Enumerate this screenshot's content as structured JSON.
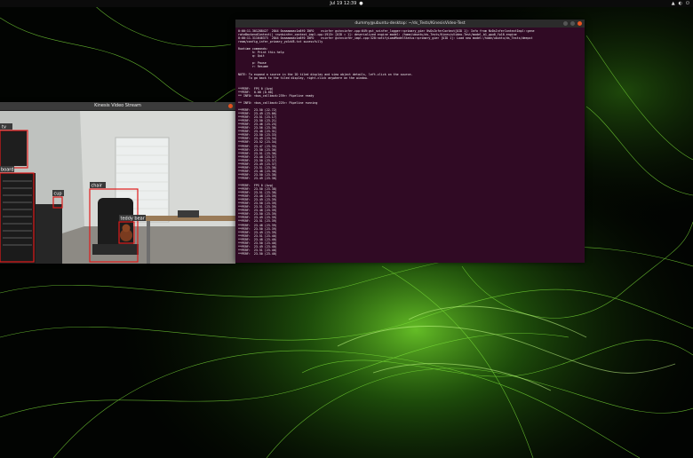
{
  "topbar": {
    "clock": "Jul 19  12:39",
    "bullet": "●",
    "tray": [
      "▲",
      "◐",
      "⏻"
    ]
  },
  "stream_window": {
    "title": "Kinesis Video Stream",
    "close": "×",
    "detections": [
      {
        "label": "tv"
      },
      {
        "label": "board"
      },
      {
        "label": "cup"
      },
      {
        "label": "chair"
      },
      {
        "label": "teddy bear"
      }
    ]
  },
  "terminal": {
    "title": "dummy@ubuntu-desktop: ~/ds_Tests/KinesisVideo-Test",
    "lines": [
      "0:00:11.301288427  2844 0xaaaaaac1a8f0 INFO    nvinfer gstnvinfer.cpp:649:gst_nvinfer_logger:<primary_gie> NvDsInferContext[UID 1]: Info from NvDsInferContextImpl::gene",
      "rateBackendContext() <nvdsinfer_context_impl.cpp:1913> [UID = 1]: deserialized engine model: /home/ubuntu/ds_Tests/KinesisVideo-Test/model_b1_gpu0_fp16.engine",
      "0:00:11.311646373  2844 0xaaaaaac1a8f0 INFO    nvinfer gstnvinfer_impl.cpp:328:notifyLoadModelStatus:<primary_gie> [UID 1]: Load new model:/home/ubuntu/ds_Tests/deepst",
      "ream/config_infer_primary_yoloV8.txt sucessfully",
      "",
      "Runtime commands:",
      "        h: Print this help",
      "        q: Quit",
      "",
      "        p: Pause",
      "        r: Resume",
      "",
      "NOTE: To expand a source in the 2D tiled display and view object details, left-click on the source.",
      "      To go back to the tiled display, right-click anywhere on the window.",
      "",
      "",
      "**PERF:  FPS 0 (Avg)",
      "**PERF:  0.00 (0.00)",
      "** INFO: <bus_callback:239>: Pipeline ready",
      "",
      "** INFO: <bus_callback:225>: Pipeline running",
      "",
      "**PERF:  23.50 (22.72)",
      "**PERF:  23.49 (23.06)",
      "**PERF:  23.51 (23.17)",
      "**PERF:  23.50 (23.21)",
      "**PERF:  23.46 (23.25)",
      "**PERF:  23.56 (23.30)",
      "**PERF:  23.48 (23.31)",
      "**PERF:  23.50 (23.33)",
      "**PERF:  23.49 (23.34)",
      "**PERF:  23.52 (23.34)",
      "**PERF:  23.47 (23.35)",
      "**PERF:  23.50 (23.36)",
      "**PERF:  23.51 (23.36)",
      "**PERF:  23.48 (23.37)",
      "**PERF:  23.50 (23.37)",
      "**PERF:  23.49 (23.37)",
      "**PERF:  23.51 (23.38)",
      "**PERF:  23.48 (23.38)",
      "**PERF:  23.50 (23.38)",
      "**PERF:  23.49 (23.38)",
      "",
      "**PERF:  FPS 0 (Avg)",
      "**PERF:  23.50 (23.38)",
      "**PERF:  23.51 (23.38)",
      "**PERF:  23.48 (23.39)",
      "**PERF:  23.49 (23.39)",
      "**PERF:  23.50 (23.39)",
      "**PERF:  23.51 (23.39)",
      "**PERF:  23.48 (23.39)",
      "**PERF:  23.50 (23.39)",
      "**PERF:  23.49 (23.39)",
      "**PERF:  23.51 (23.39)",
      "**PERF:  23.48 (23.39)",
      "**PERF:  23.50 (23.39)",
      "**PERF:  23.49 (23.39)",
      "**PERF:  23.51 (23.40)",
      "**PERF:  23.48 (23.40)",
      "**PERF:  23.50 (23.40)",
      "**PERF:  23.49 (23.40)",
      "**PERF:  23.51 (23.40)",
      "**PERF:  23.50 (23.40)"
    ]
  },
  "colors": {
    "terminal_bg": "#300a24",
    "detection_box": "#e01b1b",
    "wallpaper_glow": "#76b900"
  }
}
